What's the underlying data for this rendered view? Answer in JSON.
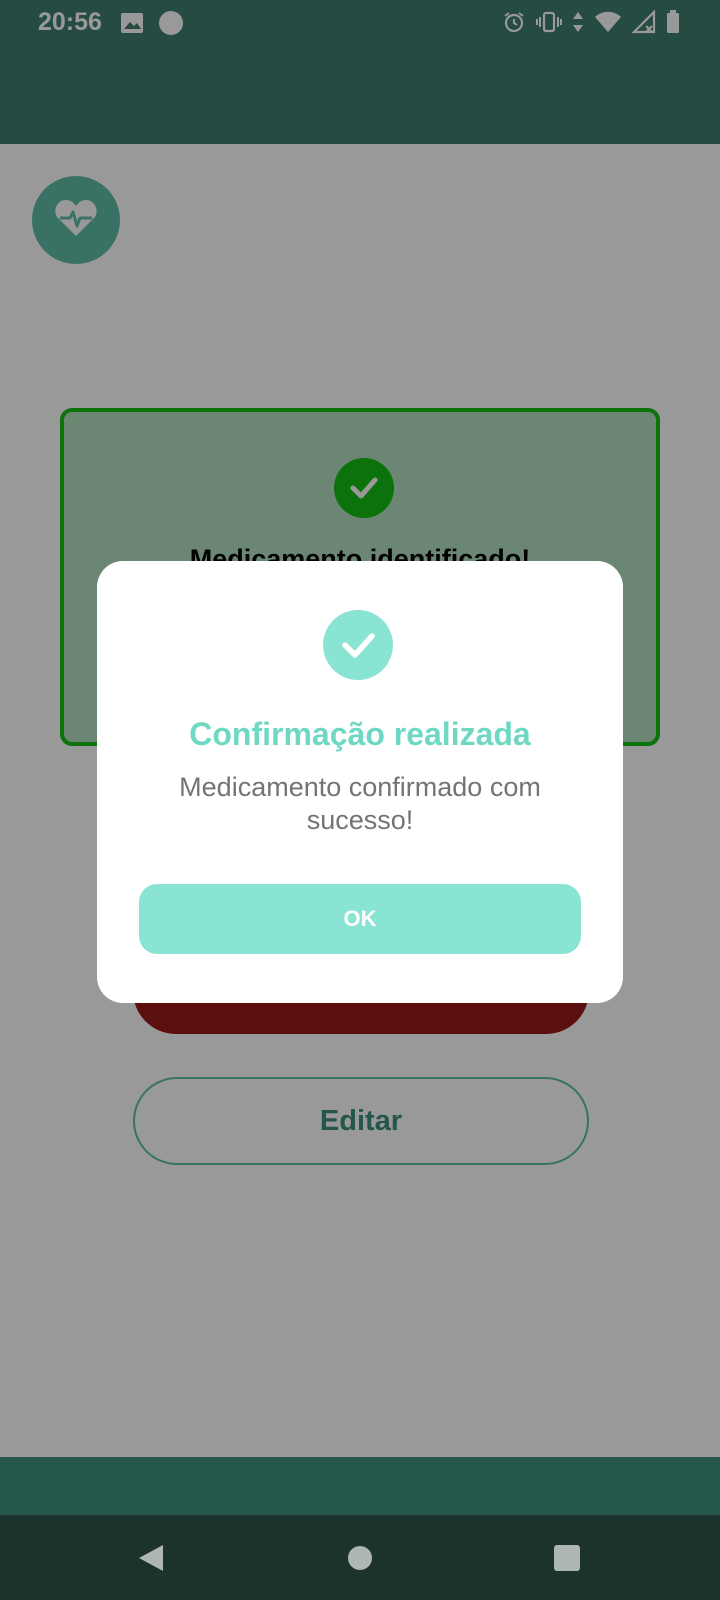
{
  "status_bar": {
    "time": "20:56",
    "icons": [
      "image-icon",
      "circle-icon",
      "alarm-icon",
      "vibrate-icon",
      "data-arrows-icon",
      "wifi-icon",
      "signal-icon",
      "battery-icon"
    ]
  },
  "background": {
    "card": {
      "title": "Medicamento identificado!"
    },
    "edit_button_label": "Editar"
  },
  "dialog": {
    "title": "Confirmação realizada",
    "message": "Medicamento confirmado com sucesso!",
    "ok_label": "OK"
  },
  "nav": {
    "icons": [
      "back-icon",
      "home-icon",
      "recents-icon"
    ]
  },
  "colors": {
    "primary": "#3f7d6f",
    "accent": "#8ae4d4",
    "success": "#14c014",
    "danger": "#9a1a1a",
    "nav_bar": "#1b332c"
  }
}
